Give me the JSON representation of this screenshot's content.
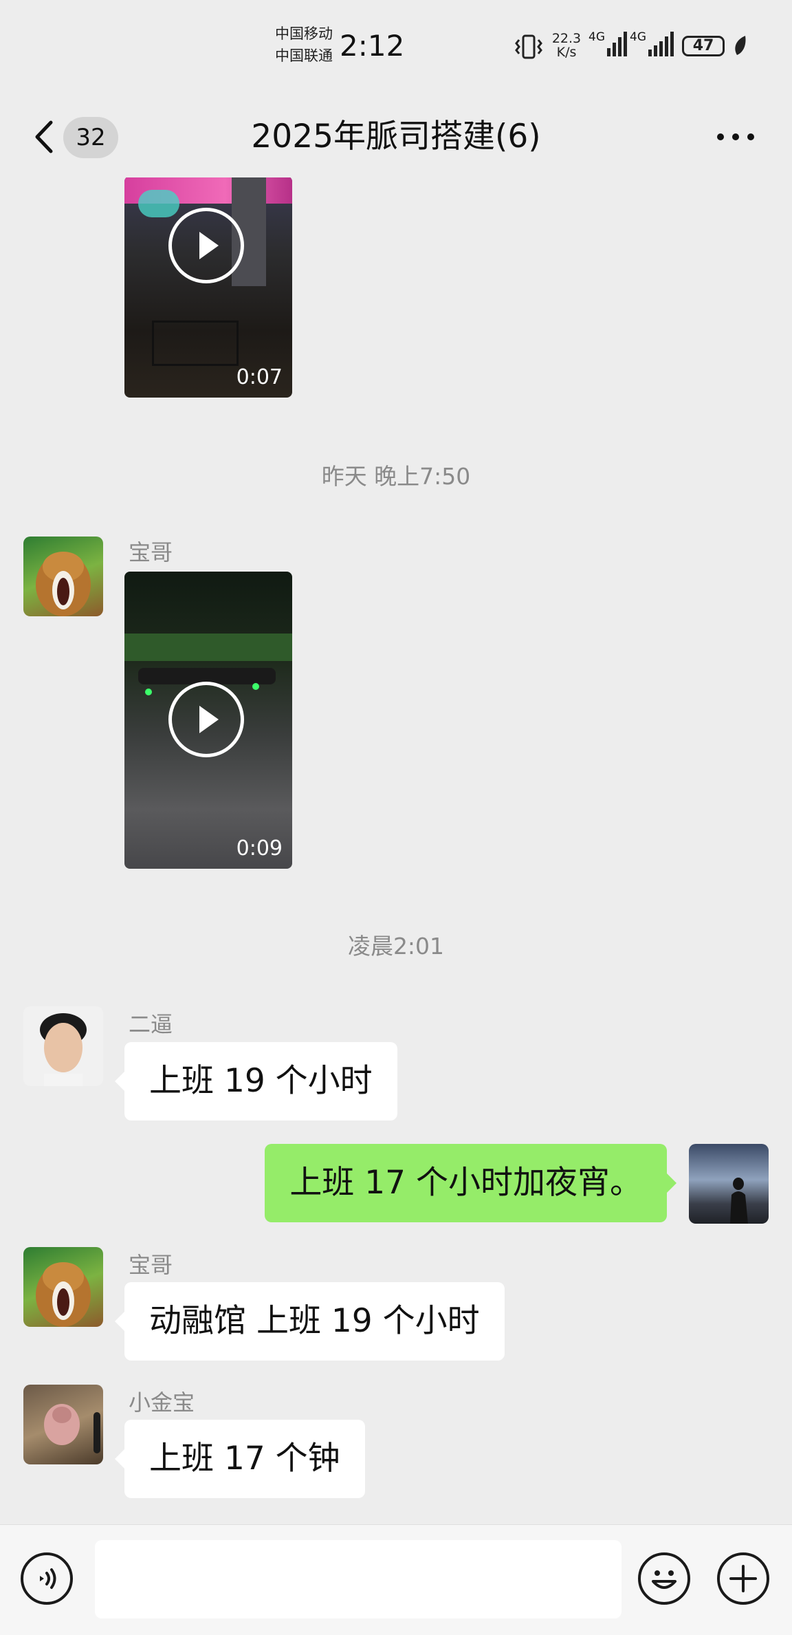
{
  "status_bar": {
    "carrier_1": "中国移动",
    "carrier_2": "中国联通",
    "time": "2:12",
    "net_speed_value": "22.3",
    "net_speed_unit": "K/s",
    "sim1_network": "4G",
    "sim2_network": "4G",
    "battery": "47",
    "icons": [
      "vibrate-icon",
      "signal-icon",
      "signal-icon",
      "battery-icon",
      "leaf-icon"
    ]
  },
  "nav": {
    "back_icon": "chevron-left-icon",
    "unread_count": "32",
    "title": "2025年脈司搭建(6)",
    "more_icon": "more-dots-icon"
  },
  "messages": [
    {
      "type": "video",
      "direction": "in",
      "duration": "0:07",
      "partial": true
    },
    {
      "type": "timestamp",
      "text": "昨天 晚上7:50"
    },
    {
      "type": "video",
      "direction": "in",
      "sender": "宝哥",
      "duration": "0:09"
    },
    {
      "type": "timestamp",
      "text": "凌晨2:01"
    },
    {
      "type": "text",
      "direction": "in",
      "sender": "二逼",
      "text": "上班 19 个小时"
    },
    {
      "type": "text",
      "direction": "out",
      "text": "上班 17 个小时加夜宵。"
    },
    {
      "type": "text",
      "direction": "in",
      "sender": "宝哥",
      "text": "动融馆  上班 19 个小时"
    },
    {
      "type": "text",
      "direction": "in",
      "sender": "小金宝",
      "text": "上班 17 个钟"
    }
  ],
  "input_bar": {
    "voice_icon": "voice-icon",
    "text_value": "",
    "emoji_icon": "emoji-icon",
    "plus_icon": "plus-icon"
  },
  "colors": {
    "background": "#ededed",
    "incoming_bubble": "#ffffff",
    "outgoing_bubble": "#95ec69",
    "meta_text": "#8a8a8a"
  }
}
